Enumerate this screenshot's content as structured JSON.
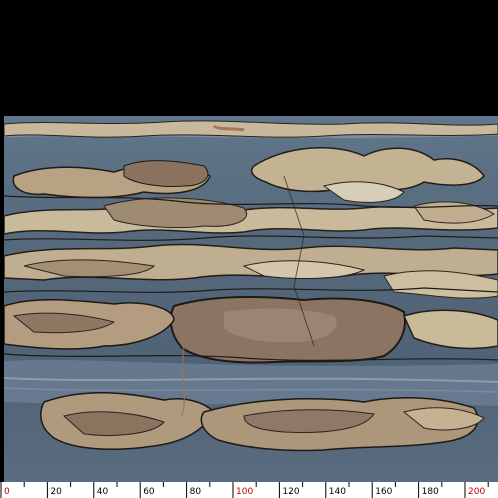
{
  "image": {
    "subject": "polished stone slab photograph with measurement ruler",
    "colors": {
      "background": "#000000",
      "slab_blue_grey": "#5c6f82",
      "slab_beige": "#c9b89a",
      "slab_brown": "#7a6250",
      "vein_dark": "#1e1b17"
    }
  },
  "ruler": {
    "labels": [
      {
        "text": "0",
        "value": 0,
        "color": "#c00000"
      },
      {
        "text": "20",
        "value": 20,
        "color": "#000000"
      },
      {
        "text": "40",
        "value": 40,
        "color": "#000000"
      },
      {
        "text": "60",
        "value": 60,
        "color": "#000000"
      },
      {
        "text": "80",
        "value": 80,
        "color": "#000000"
      },
      {
        "text": "100",
        "value": 100,
        "color": "#c00000"
      },
      {
        "text": "120",
        "value": 120,
        "color": "#000000"
      },
      {
        "text": "140",
        "value": 140,
        "color": "#000000"
      },
      {
        "text": "160",
        "value": 160,
        "color": "#000000"
      },
      {
        "text": "180",
        "value": 180,
        "color": "#000000"
      },
      {
        "text": "200",
        "value": 200,
        "color": "#c00000"
      }
    ]
  }
}
